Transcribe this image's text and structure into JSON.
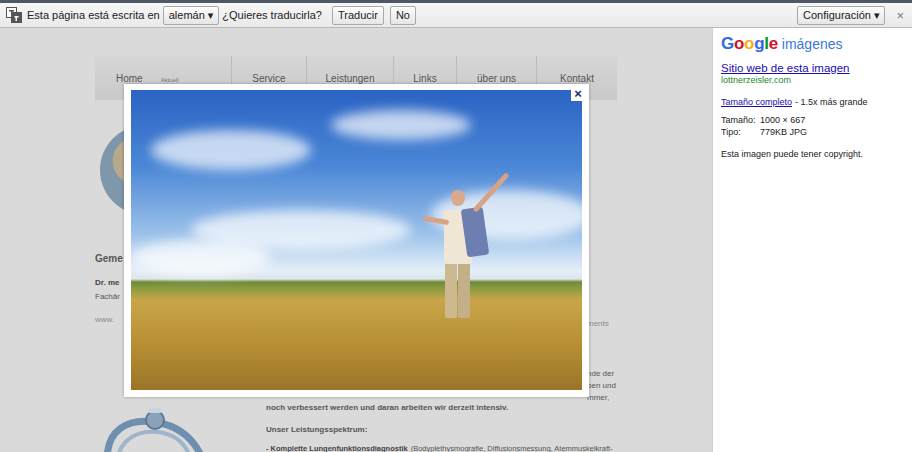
{
  "translate_bar": {
    "prefix": "Esta página está escrita en",
    "language": "alemán",
    "dropdown_arrow": "▾",
    "question": "¿Quieres traducirla?",
    "buttons": [
      "Traducir",
      "No"
    ],
    "settings": "Configuración",
    "settings_arrow": "▾",
    "close": "×"
  },
  "page": {
    "nav": [
      {
        "label": "Home",
        "sub": "Aktuell"
      },
      {
        "label": "Service"
      },
      {
        "label": "Leistungen"
      },
      {
        "label": "Links"
      },
      {
        "label": "über uns"
      },
      {
        "label": "Kontakt"
      }
    ],
    "left_fragments": {
      "heading": "Geme",
      "name": "Dr. me",
      "title": "Fachär",
      "web": "www."
    },
    "right_fragments": {
      "web_end": "ments",
      "lines": [
        "nde der",
        "ben und",
        "mmer,"
      ]
    },
    "body": {
      "line": "noch verbessert werden und daran arbeiten wir derzeit intensiv.",
      "subheading": "Unser Leistungsspektrum:",
      "item_bold": "- Komplette Lungenfunktionsdiagnostik",
      "item_rest": "(Bodyplethysmografie, Diffusionsmessung, Atemmuskelkraft-"
    }
  },
  "modal": {
    "close": "×"
  },
  "panel": {
    "logo": {
      "brand": "Google",
      "product": "imágenes"
    },
    "site_link": "Sitio web de esta imagen",
    "domain": "lottnerzeisler.com",
    "full_size": "Tamaño completo",
    "full_size_suffix": "- 1.5x más grande",
    "info": [
      {
        "label": "Tamaño:",
        "value": "1000 × 667"
      },
      {
        "label": "Tipo:",
        "value": "779KB JPG"
      }
    ],
    "copyright": "Esta imagen puede tener copyright."
  }
}
